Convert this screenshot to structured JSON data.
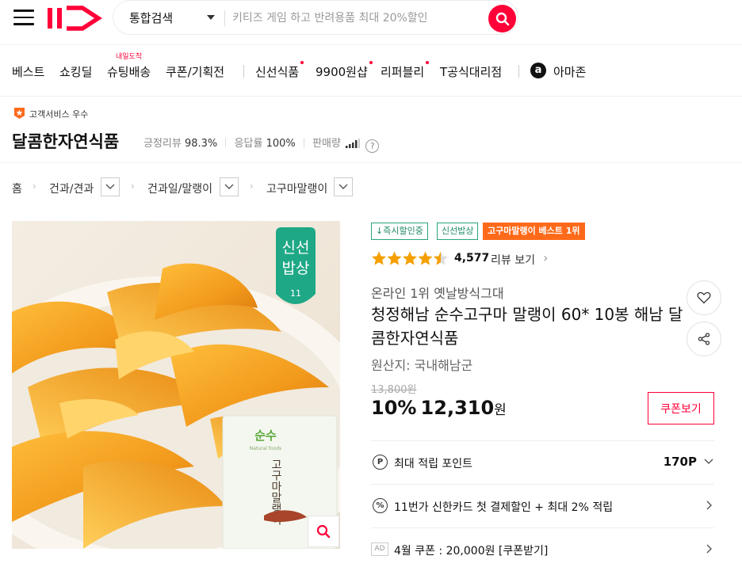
{
  "header": {
    "search_type": "통합검색",
    "search_placeholder": "키티즈 게임 하고 반려용품 최대 20%할인"
  },
  "menu": {
    "items": [
      "베스트",
      "쇼킹딜",
      "슈팅배송",
      "쿠폰/기획전",
      "신선식품",
      "9900원샵",
      "리퍼블리",
      "T공식대리점",
      "아마존"
    ],
    "badge": "내일도착",
    "amazon_icon_letter": "a"
  },
  "seller": {
    "badge": "고객서비스 우수",
    "name": "달콤한자연식품",
    "positive_review_label": "긍정리뷰",
    "positive_review_value": "98.3%",
    "response_label": "응답률",
    "response_value": "100%",
    "sales_label": "판매량",
    "help": "?"
  },
  "breadcrumb": [
    "홈",
    "건과/견과",
    "건과일/말랭이",
    "고구마말랭이"
  ],
  "image": {
    "badge_line1": "신선",
    "badge_line2": "밥상",
    "badge_logo": "11",
    "pack_brand": "순수",
    "pack_brand_sub": "Natural foods",
    "pack_title": "고구마말랭이"
  },
  "tags": [
    "↓즉시할인중",
    "신선밥상",
    "고구마말랭이 베스트 1위"
  ],
  "rating": {
    "stars": 4.5,
    "count": "4,577",
    "link": "리뷰 보기"
  },
  "product": {
    "subtitle": "온라인 1위 옛날방식그대",
    "title": "청정해남 순수고구마 말랭이 60* 10봉 해남 달콤한자연식품",
    "origin": "원산지:  국내해남군",
    "original_price": "13,800원",
    "discount": "10%",
    "price": "12,310",
    "currency": "원",
    "coupon_button": "쿠폰보기"
  },
  "benefits": [
    {
      "icon": "P",
      "text": "최대 적립 포인트",
      "value": "170P"
    },
    {
      "icon": "%",
      "text": "11번가 신한카드 첫 결제할인 + 최대 2% 적립",
      "value": ""
    },
    {
      "icon": "AD",
      "text": "4월 쿠폰 : 20,000원 [쿠폰받기]",
      "value": ""
    }
  ],
  "colors": {
    "brand": "#ff0038",
    "tag_green": "#1f8a64",
    "tag_orange": "#ff6a1a",
    "star": "#f5a000",
    "badge_teal": "#1fa886"
  }
}
